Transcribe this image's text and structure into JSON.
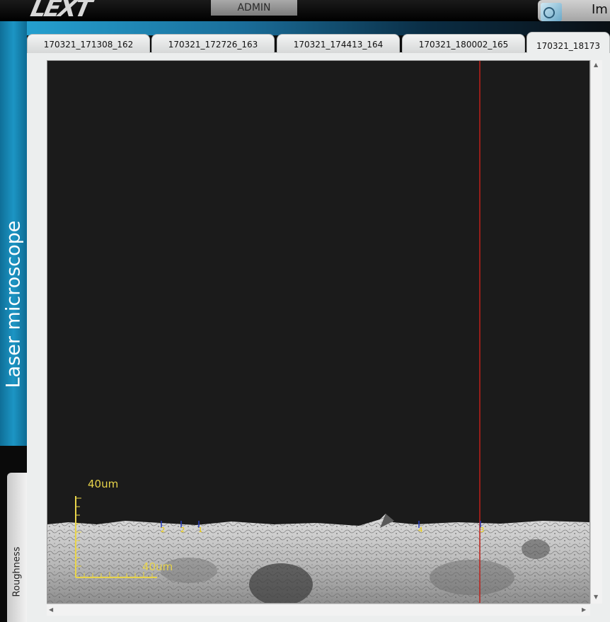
{
  "header": {
    "logo_text": "LEXT",
    "user_label": "ADMIN",
    "right_text": "Im"
  },
  "sidebar": {
    "title": "Laser microscope",
    "bottom_tab": "Roughness"
  },
  "tabs": [
    {
      "label": "170321_171308_162"
    },
    {
      "label": "170321_172726_163"
    },
    {
      "label": "170321_174413_164"
    },
    {
      "label": "170321_180002_165"
    },
    {
      "label": "170321_18173"
    }
  ],
  "image": {
    "scale_bar_vertical": "40um",
    "scale_bar_horizontal": "40um",
    "markers": [
      "2",
      "2",
      "1",
      "4",
      "3"
    ],
    "colors": {
      "cursor_line": "#c0201a",
      "scale_bar": "#e8d44a",
      "background": "#1b1b1b"
    }
  }
}
